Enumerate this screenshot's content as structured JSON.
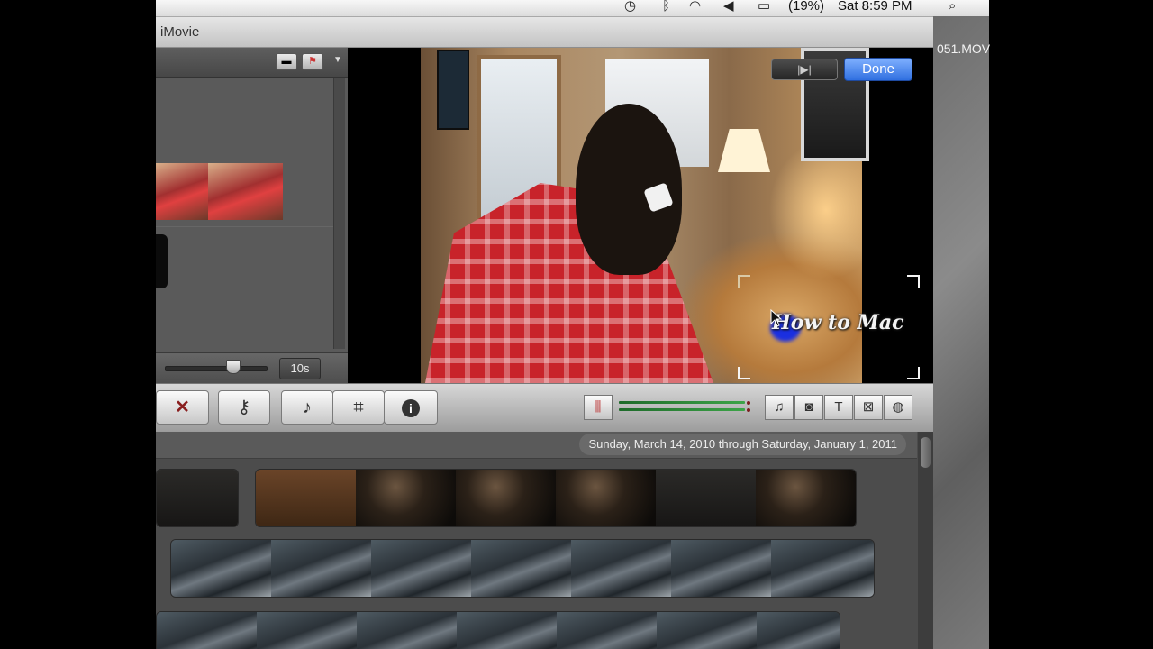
{
  "menubar": {
    "battery": "(19%)",
    "time": "Sat 8:59 PM",
    "icons": [
      "time-machine-icon",
      "bluetooth-icon",
      "wifi-icon",
      "volume-icon",
      "battery-icon",
      "spotlight-search-icon"
    ]
  },
  "window": {
    "title": "iMovie"
  },
  "desktop": {
    "file_label": "051.MOV"
  },
  "library": {
    "zoom_label": "10s"
  },
  "viewer": {
    "done_label": "Done",
    "play_label": "|▶|",
    "watermark_text": "How to Mac"
  },
  "toolbar": {
    "reject_icon": "✕",
    "keyword_icon": "⚷",
    "voiceover_icon": "🎤",
    "crop_icon": "⌗",
    "inspector_icon": "i",
    "right_buttons": [
      "♫",
      "◙",
      "T",
      "⊠",
      "◍"
    ]
  },
  "browser": {
    "date_range": "Sunday, March 14, 2010 through Saturday, January 1, 2011"
  },
  "colors": {
    "done_blue": "#2f6fe0",
    "meter_green": "#3da448"
  }
}
